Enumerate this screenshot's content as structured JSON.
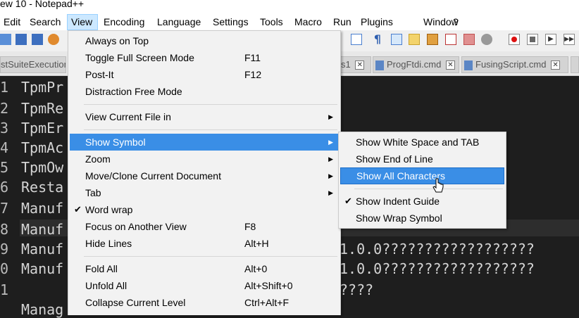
{
  "window_title": "ew 10 - Notepad++",
  "menubar": [
    "Edit",
    "Search",
    "View",
    "Encoding",
    "Language",
    "Settings",
    "Tools",
    "Macro",
    "Run",
    "Plugins",
    "Window",
    "?"
  ],
  "tabs": {
    "t0": "stSuiteExecution",
    "t1": "s1",
    "t2": "ProgFtdi.cmd",
    "t3": "FusingScript.cmd",
    "close": "✕"
  },
  "gutter": [
    "1",
    "2",
    "3",
    "4",
    "5",
    "6",
    "7",
    "8",
    "9",
    "0",
    "1",
    ""
  ],
  "code": [
    "TpmPr",
    "TpmRe",
    "TpmEr",
    "TpmAc",
    "TpmOw",
    "Resta",
    "Manuf",
    "Manuf",
    "Manuf",
    "Manuf",
    "",
    "Manag"
  ],
  "code_right": {
    "r9": "1.0.0??????????????????",
    "r10": "1.0.0??????????????????",
    "r11": "????"
  },
  "view_menu": {
    "always_on_top": "Always on Top",
    "toggle_full_screen": "Toggle Full Screen Mode",
    "toggle_full_screen_sc": "F11",
    "post_it": "Post-It",
    "post_it_sc": "F12",
    "distraction_free": "Distraction Free Mode",
    "view_current_file_in": "View Current File in",
    "show_symbol": "Show Symbol",
    "zoom": "Zoom",
    "move_clone": "Move/Clone Current Document",
    "tab": "Tab",
    "word_wrap": "Word wrap",
    "focus_other_view": "Focus on Another View",
    "focus_other_view_sc": "F8",
    "hide_lines": "Hide Lines",
    "hide_lines_sc": "Alt+H",
    "fold_all": "Fold All",
    "fold_all_sc": "Alt+0",
    "unfold_all": "Unfold All",
    "unfold_all_sc": "Alt+Shift+0",
    "collapse_current": "Collapse Current Level",
    "collapse_current_sc": "Ctrl+Alt+F",
    "arrow": "▶",
    "check": "✔"
  },
  "symbol_menu": {
    "white_space_tab": "Show White Space and TAB",
    "end_of_line": "Show End of Line",
    "all_characters": "Show All Characters",
    "indent_guide": "Show Indent Guide",
    "wrap_symbol": "Show Wrap Symbol"
  },
  "colors": {
    "highlight": "#3a8ee6",
    "editor_bg": "#1e1e1e",
    "menu_bg": "#f2f2f2"
  }
}
